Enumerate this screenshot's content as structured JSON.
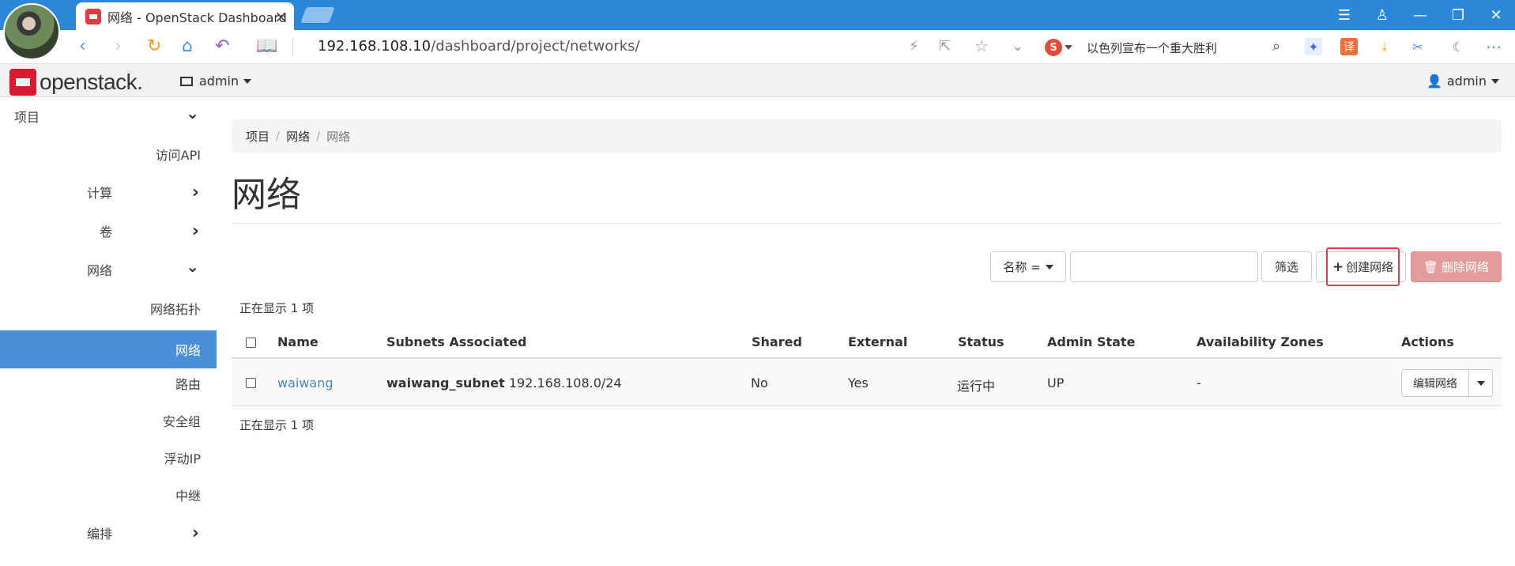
{
  "browser": {
    "tab_title": "网络 - OpenStack Dashboard",
    "tab_close": "×",
    "url_host": "192.168.108.10",
    "url_path": "/dashboard/project/networks/",
    "search_text": "以色列宣布一个重大胜利",
    "search_engine_glyph": "S",
    "translate_glyph": "译"
  },
  "navbar": {
    "logo_text": "openstack.",
    "project": "admin",
    "user": "admin"
  },
  "sidebar": {
    "items": [
      {
        "label": "项目",
        "level": 0,
        "chevron": "down"
      },
      {
        "label": "访问API",
        "level": 2
      },
      {
        "label": "计算",
        "level": 1,
        "chevron": "right"
      },
      {
        "label": "卷",
        "level": 1,
        "chevron": "right"
      },
      {
        "label": "网络",
        "level": 1,
        "chevron": "down"
      },
      {
        "label": "网络拓扑",
        "level": 2
      },
      {
        "label": "网络",
        "level": 2,
        "active": true
      },
      {
        "label": "路由",
        "level": 2
      },
      {
        "label": "安全组",
        "level": 2
      },
      {
        "label": "浮动IP",
        "level": 2
      },
      {
        "label": "中继",
        "level": 2
      },
      {
        "label": "编排",
        "level": 1,
        "chevron": "right"
      }
    ]
  },
  "breadcrumb": [
    "项目",
    "网络",
    "网络"
  ],
  "page_title": "网络",
  "toolbar": {
    "filter_field": "名称 =",
    "filter_value": "",
    "filter_button": "筛选",
    "create_button": "创建网络",
    "delete_button": "删除网络"
  },
  "table": {
    "count_text": "正在显示 1 项",
    "headers": [
      "Name",
      "Subnets Associated",
      "Shared",
      "External",
      "Status",
      "Admin State",
      "Availability Zones",
      "Actions"
    ],
    "rows": [
      {
        "name": "waiwang",
        "subnet_name": "waiwang_subnet",
        "subnet_cidr": "192.168.108.0/24",
        "shared": "No",
        "external": "Yes",
        "status": "运行中",
        "admin_state": "UP",
        "zones": "-",
        "action": "编辑网络"
      }
    ]
  },
  "colors": {
    "browser_blue": "#2b87d8",
    "sidebar_active": "#4a90d9",
    "link": "#4a86c5",
    "danger": "#e49b9b",
    "highlight": "#e8384f",
    "brand_red": "#da1a32"
  }
}
